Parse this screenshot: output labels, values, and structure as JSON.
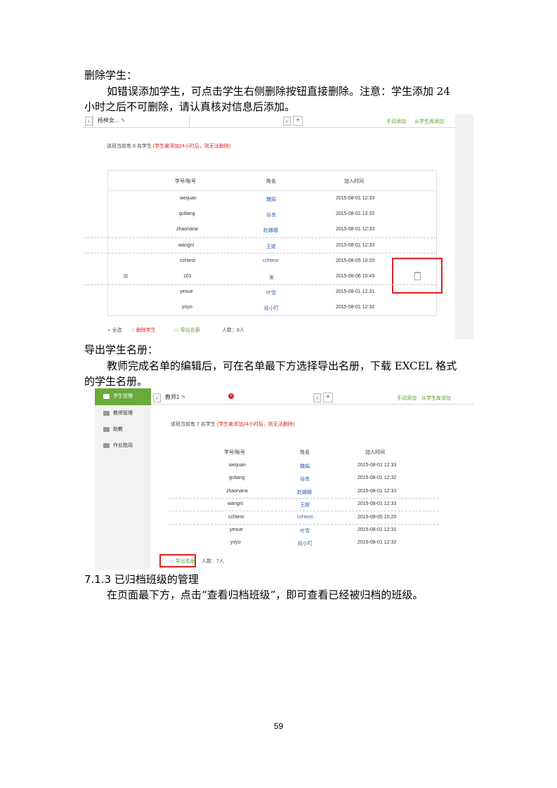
{
  "doc": {
    "heading_delete": "删除学生：",
    "para_delete_1": "如错误添加学生，可点击学生右侧删除按钮直接删除。注意：学生添加 24",
    "para_delete_2": "小时之后不可删除，请认真核对信息后添加。",
    "heading_export": "导出学生名册：",
    "para_export_1": "教师完成名单的编辑后，可在名单最下方选择导出名册，下载 EXCEL 格式",
    "para_export_2": "的学生名册。",
    "heading_archived": "7.1.3 已归档班级的管理",
    "para_archived": "在页面最下方，点击“查看归档班级”，即可查看已经被归档的班级。",
    "page_number": "59"
  },
  "shot1": {
    "tab_title": "杨林女...",
    "nav_prev": "‹",
    "nav_next": "›",
    "tab_add": "+",
    "link_create": "手动添加",
    "link_import": "从学生库添加",
    "hint_prefix": "该班当前有 8 名学生",
    "hint_red": "(学生被添加24小时后，则无法删除)",
    "columns": [
      "学号/账号",
      "姓名",
      "加入时间"
    ],
    "rows": [
      {
        "id": "weijuan",
        "name": "魏娟",
        "time": "2015-08-01 12:33"
      },
      {
        "id": "guliang",
        "name": "谷良",
        "time": "2015-08-01 12:32"
      },
      {
        "id": "zhaonana",
        "name": "赵娜娜",
        "time": "2015-08-01 12:33"
      },
      {
        "id": "wangni",
        "name": "王妮",
        "time": "2015-08-01 12:33"
      },
      {
        "id": "cchtest",
        "name": "cchtest",
        "time": "2015-08-05 10:20"
      },
      {
        "id": "101",
        "name": "发",
        "time": "2015-08-06 15:43"
      },
      {
        "id": "yexue",
        "name": "叶雪",
        "time": "2015-08-01 12:31"
      },
      {
        "id": "yoyo",
        "name": "段小叮",
        "time": "2015-08-01 12:32"
      }
    ],
    "footer_select_all": "全选",
    "footer_delete": "删除学生",
    "footer_export": "导出名册",
    "footer_count": "人数：8人"
  },
  "shot2": {
    "sidebar": [
      "学生管理",
      "教师管理",
      "助教",
      "作业批阅"
    ],
    "tab_title": "教师1",
    "close_glyph": "×",
    "nav_prev": "‹",
    "nav_next": "›",
    "tab_add": "+",
    "link_create": "手动添加",
    "link_import": "从学生库添加",
    "hint_prefix": "该班当前有 7 名学生",
    "hint_red": "(学生被添加24小时后，则无法删除)",
    "columns": [
      "学号/账号",
      "姓名",
      "加入时间"
    ],
    "rows": [
      {
        "id": "weijuan",
        "name": "魏娟",
        "time": "2015-08-01 12:33"
      },
      {
        "id": "guliang",
        "name": "谷良",
        "time": "2015-08-01 12:32"
      },
      {
        "id": "zhaonana",
        "name": "赵娜娜",
        "time": "2015-08-01 12:33"
      },
      {
        "id": "wangni",
        "name": "王妮",
        "time": "2015-08-01 12:33"
      },
      {
        "id": "cchtest",
        "name": "cchtest",
        "time": "2015-08-05 10:20"
      },
      {
        "id": "yexue",
        "name": "叶雪",
        "time": "2015-08-01 12:31"
      },
      {
        "id": "yoyo",
        "name": "段小叮",
        "time": "2015-08-01 12:32"
      }
    ],
    "footer_export": "导出名册",
    "footer_count": "人数：7人"
  }
}
